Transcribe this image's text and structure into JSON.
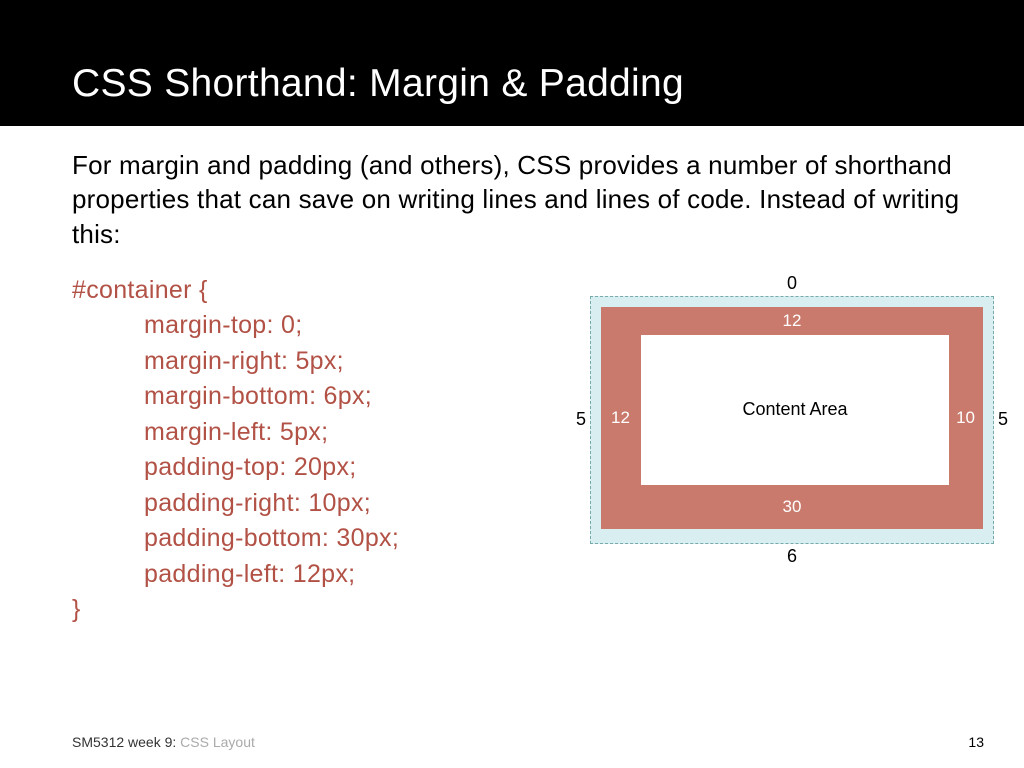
{
  "header": {
    "title": "CSS Shorthand: Margin & Padding"
  },
  "intro": "For margin and padding (and others), CSS provides a number of shorthand properties that can save on writing lines and lines of code. Instead of writing this:",
  "code": {
    "open": "#container {",
    "l1": "margin-top: 0;",
    "l2": "margin-right: 5px;",
    "l3": "margin-bottom: 6px;",
    "l4": "margin-left: 5px;",
    "l5": "padding-top: 20px;",
    "l6": "padding-right: 10px;",
    "l7": "padding-bottom: 30px;",
    "l8": "padding-left: 12px;",
    "close": "}"
  },
  "diagram": {
    "margin_top": "0",
    "margin_right": "5",
    "margin_bottom": "6",
    "margin_left": "5",
    "padding_top": "12",
    "padding_right": "10",
    "padding_bottom": "30",
    "padding_left": "12",
    "content_label": "Content Area"
  },
  "footer": {
    "course_strong": "SM5312 week 9: ",
    "course_grey": "CSS Layout",
    "page": "13"
  }
}
